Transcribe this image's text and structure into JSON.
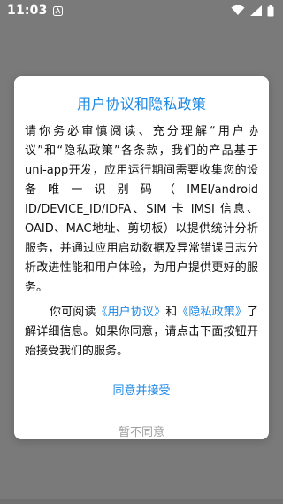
{
  "status_bar": {
    "time": "11:03",
    "notification_icon": "a-icon",
    "wifi_icon": "wifi-icon",
    "signal_icon": "signal-icon",
    "battery_icon": "battery-icon"
  },
  "dialog": {
    "title": "用户协议和隐私政策",
    "paragraph1": "请你务必审慎阅读、充分理解“用户协议”和“隐私政策”各条款，我们的产品基于uni-app开发，应用运行期间需要收集您的设备唯一识别码（IMEI/android ID/DEVICE_ID/IDFA、SIM 卡 IMSI 信息、OAID、MAC地址、剪切板）以提供统计分析服务，并通过应用启动数据及异常错误日志分析改进性能和用户体验，为用户提供更好的服务。",
    "p2_prefix": "你可阅读",
    "user_agreement_link": "《用户协议》",
    "p2_and": "和",
    "privacy_link": "《隐私政策》",
    "p2_suffix": "了解详细信息。如果你同意，请点击下面按钮开始接受我们的服务。",
    "accept_label": "同意并接受",
    "decline_label": "暂不同意"
  },
  "colors": {
    "accent": "#1e88e5",
    "overlay": "#7a7a7a",
    "muted": "#9e9e9e"
  }
}
